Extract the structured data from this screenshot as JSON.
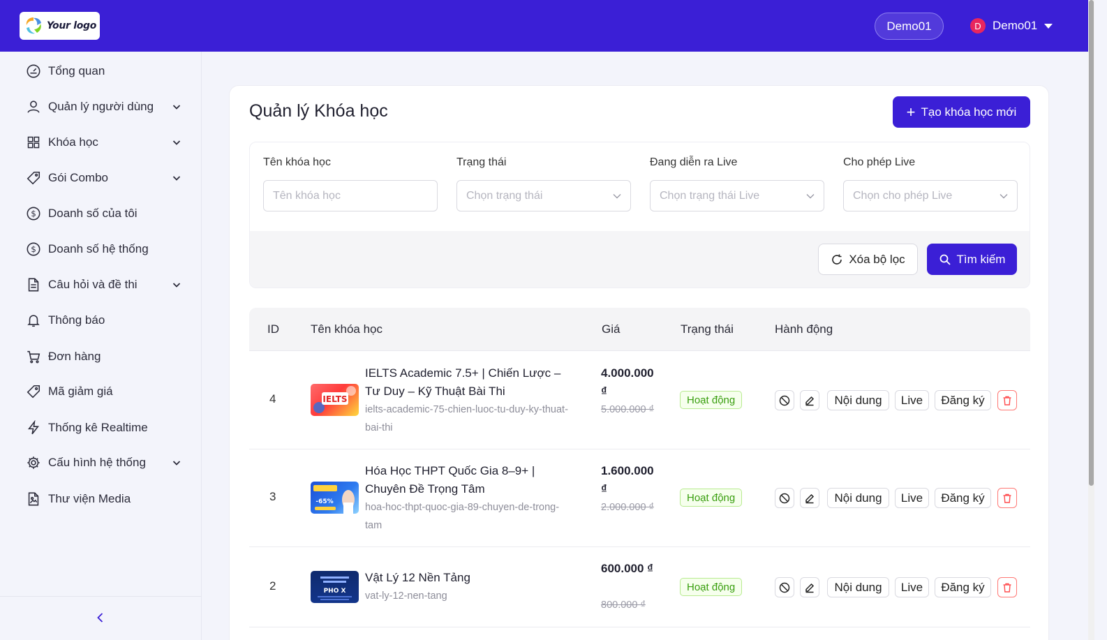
{
  "header": {
    "logo_text": "Your logo",
    "workspace_pill": "Demo01",
    "user_initial": "D",
    "user_name": "Demo01"
  },
  "sidebar": {
    "items": [
      {
        "label": "Tổng quan",
        "icon": "dashboard-icon",
        "has_children": false
      },
      {
        "label": "Quản lý người dùng",
        "icon": "user-icon",
        "has_children": true
      },
      {
        "label": "Khóa học",
        "icon": "grid-icon",
        "has_children": true
      },
      {
        "label": "Gói Combo",
        "icon": "tag-icon",
        "has_children": true
      },
      {
        "label": "Doanh số của tôi",
        "icon": "dollar-icon",
        "has_children": false
      },
      {
        "label": "Doanh số hệ thống",
        "icon": "dollar-icon",
        "has_children": false
      },
      {
        "label": "Câu hỏi và đề thi",
        "icon": "document-icon",
        "has_children": true
      },
      {
        "label": "Thông báo",
        "icon": "bell-icon",
        "has_children": false
      },
      {
        "label": "Đơn hàng",
        "icon": "cart-icon",
        "has_children": false
      },
      {
        "label": "Mã giảm giá",
        "icon": "tag-icon",
        "has_children": false
      },
      {
        "label": "Thống kê Realtime",
        "icon": "lightning-icon",
        "has_children": false
      },
      {
        "label": "Cấu hình hệ thống",
        "icon": "gear-icon",
        "has_children": true
      },
      {
        "label": "Thư viện Media",
        "icon": "file-image-icon",
        "has_children": false
      }
    ]
  },
  "page": {
    "title": "Quản lý Khóa học",
    "create_button": "Tạo khóa học mới"
  },
  "filters": {
    "course_name": {
      "label": "Tên khóa học",
      "placeholder": "Tên khóa học"
    },
    "status": {
      "label": "Trạng thái",
      "placeholder": "Chọn trạng thái"
    },
    "live_ongoing": {
      "label": "Đang diễn ra Live",
      "placeholder": "Chọn trạng thái Live"
    },
    "live_allowed": {
      "label": "Cho phép Live",
      "placeholder": "Chọn cho phép Live"
    },
    "reset_button": "Xóa bộ lọc",
    "search_button": "Tìm kiếm"
  },
  "table": {
    "columns": [
      "ID",
      "Tên khóa học",
      "Giá",
      "Trạng thái",
      "Hành động"
    ],
    "action_labels": {
      "content": "Nội dung",
      "live": "Live",
      "register": "Đăng ký"
    },
    "rows": [
      {
        "id": "4",
        "title": "IELTS Academic 7.5+ | Chiến Lược – Tư Duy – Kỹ Thuật Bài Thi",
        "slug": "ielts-academic-75-chien-luoc-tu-duy-ky-thuat-bai-thi",
        "price": "4.000.000 ₫",
        "old_price": "5.000.000 ₫",
        "status": "Hoạt động",
        "thumb_text": "IELTS"
      },
      {
        "id": "3",
        "title": "Hóa Học THPT Quốc Gia 8–9+ | Chuyên Đề Trọng Tâm",
        "slug": "hoa-hoc-thpt-quoc-gia-89-chuyen-de-trong-tam",
        "price": "1.600.000 ₫",
        "old_price": "2.000.000 ₫",
        "status": "Hoạt động",
        "thumb_text": "-65%"
      },
      {
        "id": "2",
        "title": "Vật Lý 12 Nền Tảng",
        "slug": "vat-ly-12-nen-tang",
        "price": "600.000 ₫",
        "old_price": "800.000 ₫",
        "status": "Hoạt động",
        "thumb_text": "PHO X"
      }
    ]
  },
  "colors": {
    "primary": "#3b1fd6",
    "success": "#389e0d",
    "danger": "#ff4d4f",
    "avatar": "#e8265e"
  }
}
